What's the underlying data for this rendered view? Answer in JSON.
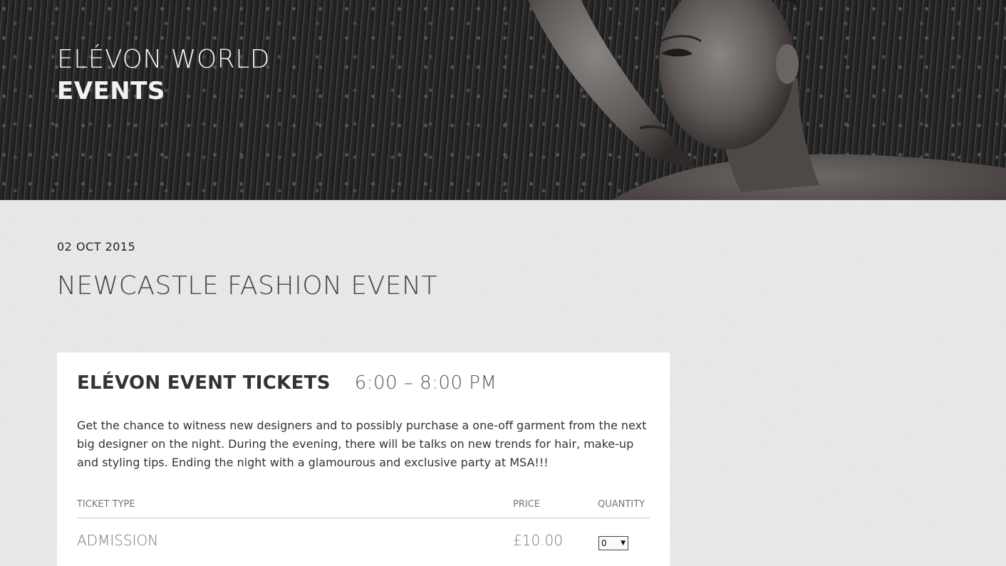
{
  "hero": {
    "title_line1": "ELÉVON WORLD",
    "title_line2": "EVENTS"
  },
  "event": {
    "date": "02 OCT 2015",
    "title": "NEWCASTLE FASHION EVENT"
  },
  "tickets": {
    "heading": "ELÉVON EVENT TICKETS",
    "time": "6:00 – 8:00 PM",
    "description": "Get the chance to witness new designers and to possibly purchase a one-off garment from the next big designer on the night. During the evening, there will be talks on new trends for hair, make-up and styling tips. Ending the night with a glamourous and exclusive party at MSA!!!",
    "columns": {
      "type": "TICKET TYPE",
      "price": "PRICE",
      "quantity": "QUANTITY"
    },
    "rows": [
      {
        "type": "ADMISSION",
        "price": "£10.00",
        "quantity": "0"
      }
    ]
  }
}
